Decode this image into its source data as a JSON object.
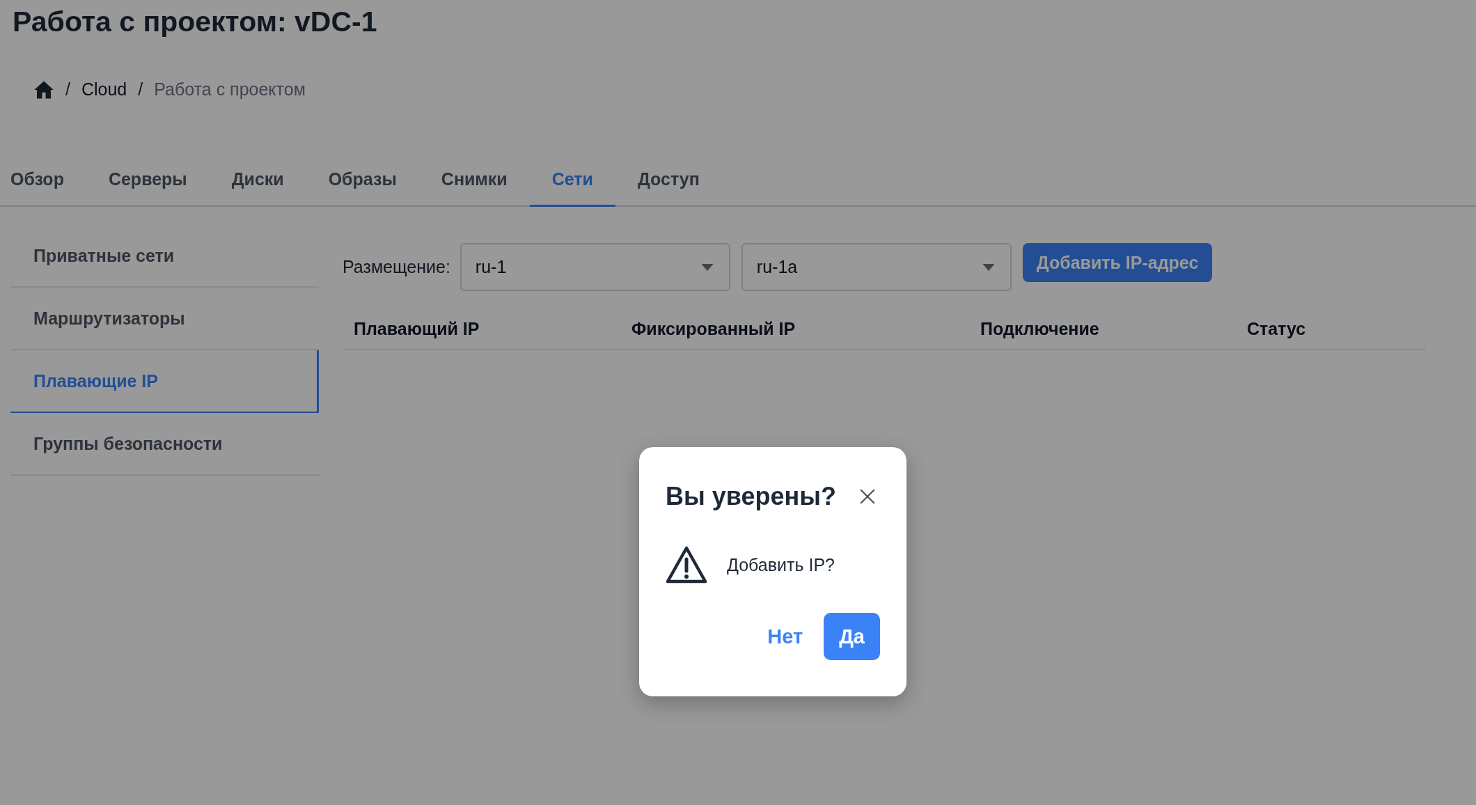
{
  "page_title": "Работа с проектом: vDC-1",
  "breadcrumb": [
    {
      "separator": "/",
      "label": "Cloud",
      "kind": "link"
    },
    {
      "separator": "/",
      "label": "Работа с проектом",
      "kind": "current"
    }
  ],
  "tabs": [
    {
      "label": "Обзор",
      "selected": false
    },
    {
      "label": "Серверы",
      "selected": false
    },
    {
      "label": "Диски",
      "selected": false
    },
    {
      "label": "Образы",
      "selected": false
    },
    {
      "label": "Снимки",
      "selected": false
    },
    {
      "label": "Сети",
      "selected": true
    },
    {
      "label": "Доступ",
      "selected": false
    }
  ],
  "sidebar": {
    "items": [
      {
        "label": "Приватные сети",
        "selected": false
      },
      {
        "label": "Маршрутизаторы",
        "selected": false
      },
      {
        "label": "Плавающие IP",
        "selected": true
      },
      {
        "label": "Группы безопасности",
        "selected": false
      }
    ]
  },
  "toolbar": {
    "placement_label": "Размещение:",
    "region_select": {
      "value": "ru-1"
    },
    "zone_select": {
      "value": "ru-1a"
    },
    "add_button": "Добавить IP-адрес"
  },
  "table": {
    "columns": [
      "Плавающий IP",
      "Фиксированный IP",
      "Подключение",
      "Статус"
    ]
  },
  "dialog": {
    "title": "Вы уверены?",
    "message": "Добавить IP?",
    "buttons": [
      {
        "label": "Нет",
        "kind": "text"
      },
      {
        "label": "Да",
        "kind": "primary"
      }
    ]
  }
}
